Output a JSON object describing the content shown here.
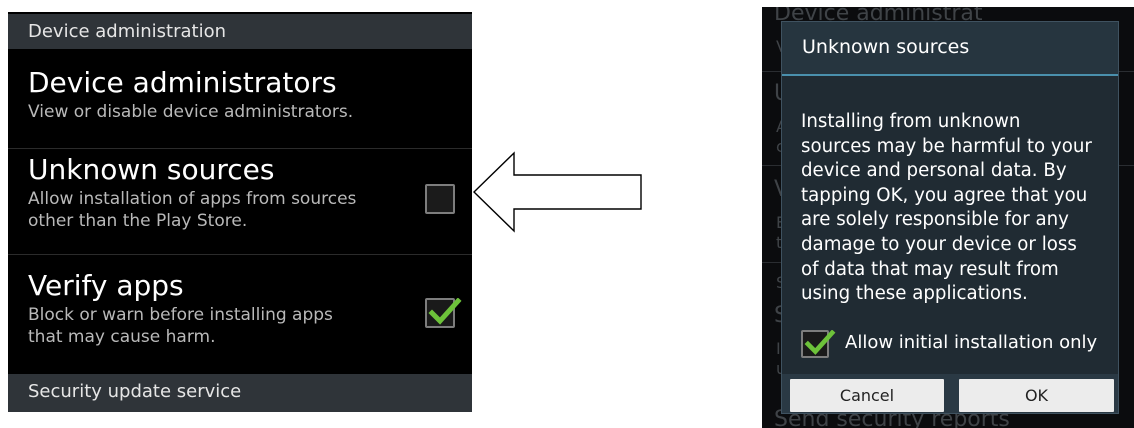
{
  "settings": {
    "device_admin_header": "Device administration",
    "items": [
      {
        "title": "Device administrators",
        "summary": "View or disable device administrators.",
        "has_checkbox": false
      },
      {
        "title": "Unknown sources",
        "summary": "Allow installation of apps from sources\nother than the Play Store.",
        "has_checkbox": true,
        "checked": false
      },
      {
        "title": "Verify apps",
        "summary": "Block or warn before installing apps\nthat may cause harm.",
        "has_checkbox": true,
        "checked": true
      }
    ],
    "security_update_header": "Security update service"
  },
  "arrow": {
    "direction": "left",
    "icon": "arrow-left-icon"
  },
  "dialog": {
    "title": "Unknown sources",
    "message": "Installing from unknown\nsources may be harmful to your\ndevice and personal data. By\ntapping OK, you agree that you\nare solely responsible for any\ndamage to your device or loss\nof data that may result from\nusing these applications.",
    "allow_checkbox_label": "Allow initial installation only",
    "allow_checkbox_checked": true,
    "cancel_label": "Cancel",
    "ok_label": "OK"
  },
  "background_fragments": {
    "top": "Device administrat",
    "t1": "V",
    "u1": "U",
    "a1": "A",
    "c1": "c",
    "v2": "V",
    "e2": "E",
    "t2": "t",
    "s3": "S",
    "s4": "S",
    "l4": "I",
    "u4": "u",
    "bottom": "Send security reports"
  },
  "colors": {
    "check_green": "#6dc23a",
    "dialog_accent": "#4a90ad",
    "header_bg": "#2f3439"
  }
}
